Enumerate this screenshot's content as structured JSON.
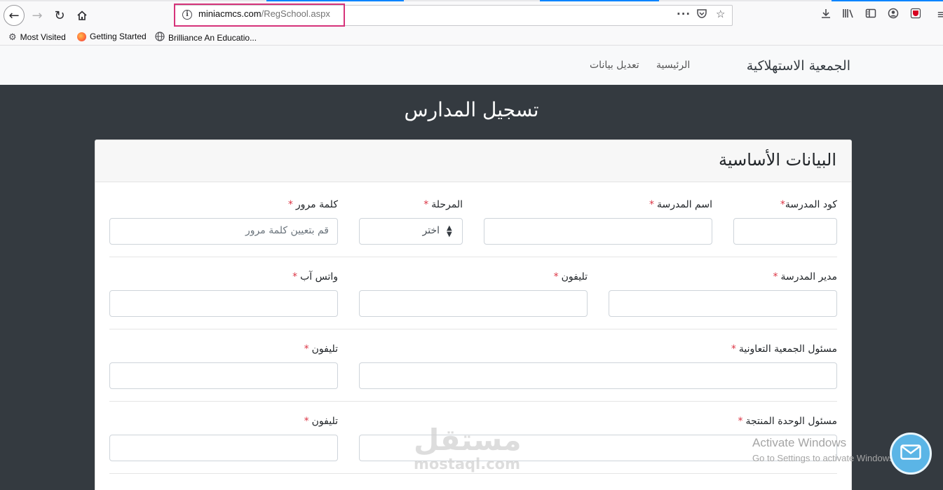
{
  "browser": {
    "url_domain": "miniacmcs.com",
    "url_path": "/RegSchool.aspx",
    "bookmarks": [
      {
        "label": "Most Visited",
        "icon": "gear-icon"
      },
      {
        "label": "Getting Started",
        "icon": "firefox-icon"
      },
      {
        "label": "Brilliance An Educatio...",
        "icon": "globe-icon"
      }
    ]
  },
  "site": {
    "brand": "الجمعية الاستهلاكية",
    "nav": [
      "الرئيسية",
      "تعديل بيانات"
    ]
  },
  "page": {
    "title": "تسجيل المدارس",
    "section_title": "البيانات الأساسية",
    "required_marker": "*",
    "fields": {
      "school_code": {
        "label": "كود المدرسة",
        "value": ""
      },
      "school_name": {
        "label": "اسم المدرسة",
        "value": ""
      },
      "stage": {
        "label": "المرحلة",
        "selected": "اختر"
      },
      "password": {
        "label": "كلمة مرور",
        "placeholder": "قم بتعيين كلمة مرور"
      },
      "principal": {
        "label": "مدير المدرسة",
        "value": ""
      },
      "principal_phone": {
        "label": "تليفون",
        "value": ""
      },
      "whatsapp": {
        "label": "واتس آب",
        "value": ""
      },
      "coop_officer": {
        "label": "مسئول الجمعية التعاونية",
        "value": ""
      },
      "coop_phone": {
        "label": "تليفون",
        "value": ""
      },
      "unit_officer": {
        "label": "مسئول الوحدة المنتجة",
        "value": ""
      },
      "unit_phone": {
        "label": "تليفون",
        "value": ""
      }
    }
  },
  "overlays": {
    "watermark_ar": "مستقل",
    "watermark_en": "mostaql.com",
    "activate_title": "Activate Windows",
    "activate_sub": "Go to Settings to activate Windows."
  },
  "colors": {
    "accent_tab": "#0a84ff",
    "url_highlight": "#d6337a",
    "page_bg": "#343a40",
    "required": "#dc3545",
    "fab": "#5bb5e6"
  }
}
